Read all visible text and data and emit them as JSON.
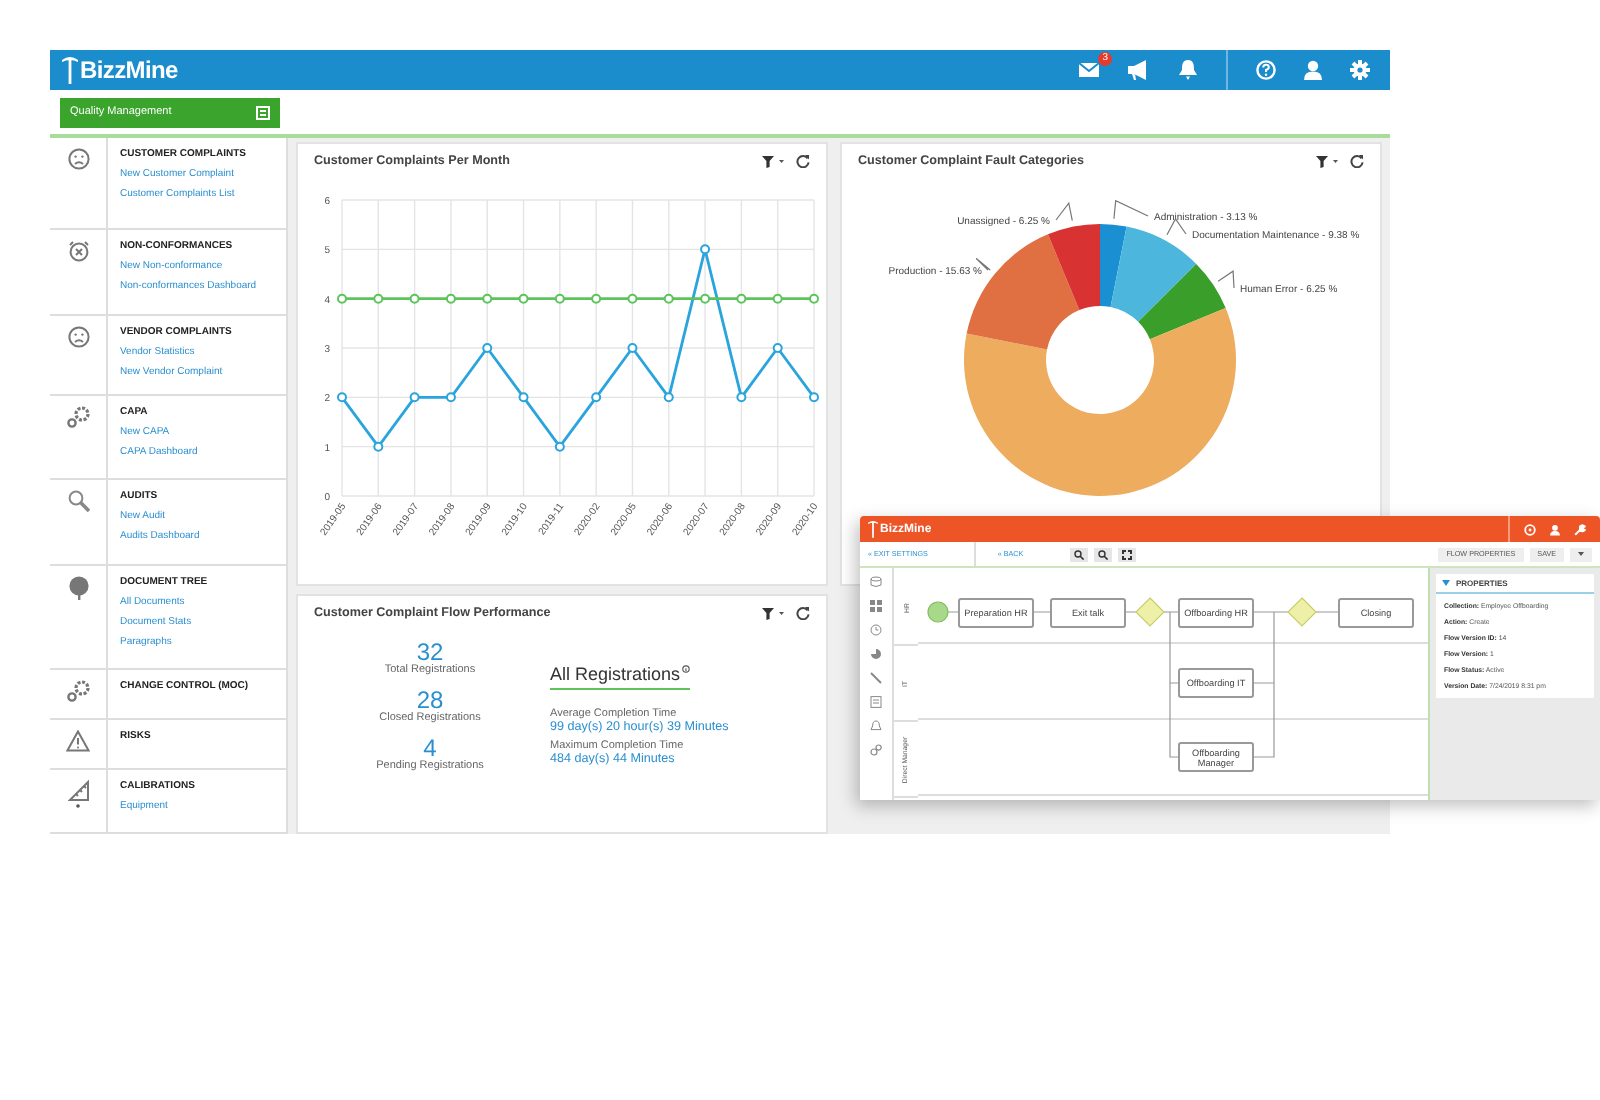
{
  "app_bar": {
    "logo": "BizzMine",
    "mail_badge": "3"
  },
  "module_button": {
    "label": "Quality Management"
  },
  "sidebar": {
    "sections": [
      {
        "title": "CUSTOMER COMPLAINTS",
        "links": [
          "New Customer Complaint",
          "Customer Complaints List"
        ]
      },
      {
        "title": "NON-CONFORMANCES",
        "links": [
          "New Non-conformance",
          "Non-conformances Dashboard"
        ]
      },
      {
        "title": "VENDOR COMPLAINTS",
        "links": [
          "Vendor Statistics",
          "New Vendor Complaint"
        ]
      },
      {
        "title": "CAPA",
        "links": [
          "New CAPA",
          "CAPA Dashboard"
        ]
      },
      {
        "title": "AUDITS",
        "links": [
          "New Audit",
          "Audits Dashboard"
        ]
      },
      {
        "title": "DOCUMENT TREE",
        "links": [
          "All Documents",
          "Document Stats",
          "Paragraphs"
        ]
      },
      {
        "title": "CHANGE CONTROL (MOC)"
      },
      {
        "title": "RISKS"
      },
      {
        "title": "CALIBRATIONS",
        "links": [
          "Equipment"
        ]
      }
    ]
  },
  "complaints_per_month": {
    "title": "Customer Complaints Per Month",
    "chart_data": {
      "type": "line",
      "categories": [
        "2019-05",
        "2019-06",
        "2019-07",
        "2019-08",
        "2019-09",
        "2019-10",
        "2019-11",
        "2020-02",
        "2020-05",
        "2020-06",
        "2020-07",
        "2020-08",
        "2020-09",
        "2020-10"
      ],
      "ylim": [
        0,
        6
      ],
      "yticks": [
        0,
        1,
        2,
        3,
        4,
        5,
        6
      ],
      "grid": true,
      "series": [
        {
          "color": "#2aa4dc",
          "marker": "circle",
          "values": [
            2,
            1,
            2,
            2,
            3,
            2,
            1,
            2,
            3,
            2,
            5,
            2,
            3,
            2
          ]
        },
        {
          "color": "#5cc45a",
          "marker": "circle",
          "values": [
            4,
            4,
            4,
            4,
            4,
            4,
            4,
            4,
            4,
            4,
            4,
            4,
            4,
            4
          ]
        }
      ]
    }
  },
  "fault_categories": {
    "title": "Customer Complaint Fault Categories",
    "chart_data": {
      "type": "donut",
      "categories": [
        "Administration -",
        "Documentation Maintenance -",
        "Human Error -",
        null,
        "Production -",
        "Unassigned -"
      ],
      "values": [
        3.13,
        9.38,
        6.25,
        59.36,
        15.63,
        6.25
      ],
      "colors": [
        "#1a90d2",
        "#4cb6dc",
        "#3a9e2a",
        "#eeac5e",
        "#e07042",
        "#d83232"
      ],
      "value_labels": [
        "3.13 %",
        "9.38 %",
        "6.25 %",
        null,
        "15.63 %",
        "6.25 %"
      ]
    }
  },
  "flow_performance": {
    "title": "Customer Complaint Flow Performance",
    "stats": [
      {
        "value": "32",
        "label": "Total Registrations"
      },
      {
        "value": "28",
        "label": "Closed Registrations"
      },
      {
        "value": "4",
        "label": "Pending Registrations"
      }
    ],
    "heading": "All Registrations",
    "metrics": [
      {
        "label": "Average Completion Time",
        "value": "99 day(s) 20 hour(s) 39 Minutes"
      },
      {
        "label": "Maximum Completion Time",
        "value": "484 day(s) 44 Minutes"
      }
    ]
  },
  "flow_designer": {
    "logo": "BizzMine",
    "exit_link": "« EXIT SETTINGS",
    "back_link": "« BACK",
    "flow_properties_button": "FLOW PROPERTIES",
    "save_button": "SAVE",
    "lanes": [
      "HR",
      "IT",
      "Direct Manager"
    ],
    "nodes": [
      {
        "kind": "start"
      },
      {
        "kind": "task",
        "label": "Preparation HR"
      },
      {
        "kind": "task",
        "label": "Exit talk"
      },
      {
        "kind": "gateway"
      },
      {
        "kind": "task",
        "label": "Offboarding HR"
      },
      {
        "kind": "task",
        "label": "Offboarding IT"
      },
      {
        "kind": "task",
        "label": "Offboarding Manager"
      },
      {
        "kind": "gateway"
      },
      {
        "kind": "task",
        "label": "Closing"
      }
    ],
    "properties": {
      "title": "PROPERTIES",
      "fields": [
        {
          "label": "Collection:",
          "value": "Employee Offboarding"
        },
        {
          "label": "Action:",
          "value": "Create"
        },
        {
          "label": "Flow Version ID:",
          "value": "14"
        },
        {
          "label": "Flow Version:",
          "value": "1"
        },
        {
          "label": "Flow Status:",
          "value": "Active"
        },
        {
          "label": "Version Date:",
          "value": "7/24/2019 8:31 pm"
        }
      ]
    }
  }
}
